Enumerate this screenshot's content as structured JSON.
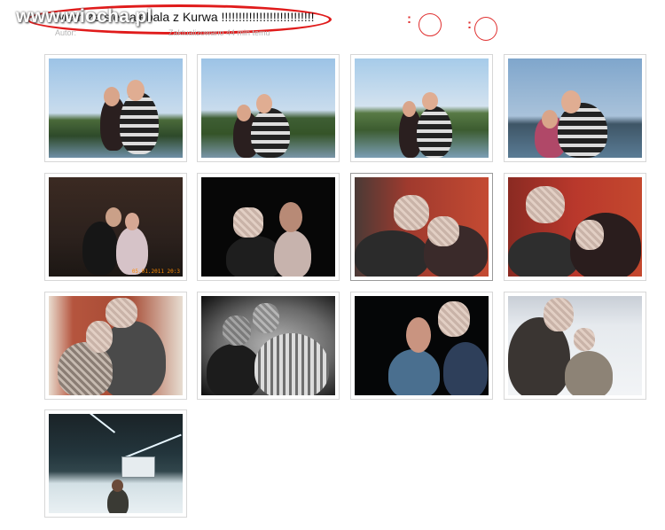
{
  "header": {
    "title": "wiem ze sie zajebala z Kurwa !!!!!!!!!!!!!!!!!!!!!!!!!!!",
    "watermark": "www.wiocha.pl",
    "author_label": "Autor:",
    "updated_text": "Zaktualizowano 44 min temu",
    "annotation_dots": ":"
  },
  "gallery": {
    "photos": [
      {
        "scene": "lake-sunset"
      },
      {
        "scene": "lake-sunset"
      },
      {
        "scene": "lake-sunset"
      },
      {
        "scene": "lake-blue"
      },
      {
        "scene": "dark-room",
        "stamp": "05.01.2011 20:3"
      },
      {
        "scene": "dark-portrait"
      },
      {
        "scene": "red-wall"
      },
      {
        "scene": "red-wall"
      },
      {
        "scene": "red-door"
      },
      {
        "scene": "bw-vignette"
      },
      {
        "scene": "night-flash"
      },
      {
        "scene": "ice-rink-selfie"
      },
      {
        "scene": "ice-rink-hall"
      }
    ]
  },
  "colors": {
    "annotation_red": "#e01b1b",
    "border": "#d7d7d7"
  }
}
